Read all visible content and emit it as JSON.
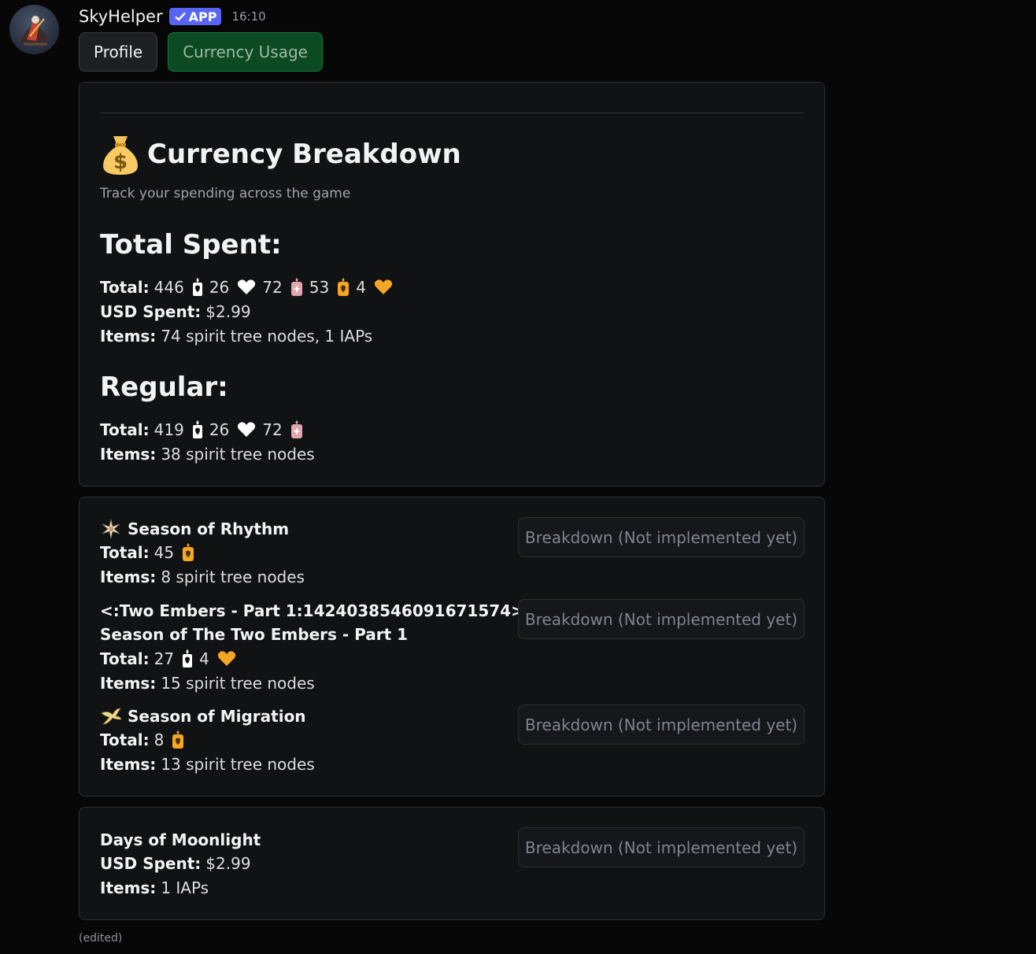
{
  "message": {
    "username": "SkyHelper",
    "badge": "APP",
    "timestamp": "16:10",
    "edited": "(edited)"
  },
  "buttons": {
    "profile": "Profile",
    "currency_usage": "Currency Usage"
  },
  "breakdown_card": {
    "title": "Currency Breakdown",
    "subtitle": "Track your spending across the game",
    "total_spent": {
      "heading": "Total Spent:",
      "total_label": "Total:",
      "values": [
        "446",
        "26",
        "72",
        "53",
        "4"
      ],
      "usd_label": "USD Spent:",
      "usd_value": "$2.99",
      "items_label": "Items:",
      "items_value": "74 spirit tree nodes, 1 IAPs"
    },
    "regular": {
      "heading": "Regular:",
      "total_label": "Total:",
      "values": [
        "419",
        "26",
        "72"
      ],
      "items_label": "Items:",
      "items_value": "38 spirit tree nodes"
    }
  },
  "seasons": [
    {
      "title": "Season of Rhythm",
      "total_label": "Total:",
      "values": [
        "45"
      ],
      "items_label": "Items:",
      "items_value": "8 spirit tree nodes",
      "button": "Breakdown (Not implemented yet)"
    },
    {
      "title_line1": "<:Two Embers - Part 1:1424038546091671574>",
      "title_line2": "Season of The Two Embers - Part 1",
      "total_label": "Total:",
      "values": [
        "27",
        "4"
      ],
      "items_label": "Items:",
      "items_value": "15 spirit tree nodes",
      "button": "Breakdown (Not implemented yet)"
    },
    {
      "title": "Season of Migration",
      "total_label": "Total:",
      "values": [
        "8"
      ],
      "items_label": "Items:",
      "items_value": "13 spirit tree nodes",
      "button": "Breakdown (Not implemented yet)"
    }
  ],
  "event": {
    "title": "Days of Moonlight",
    "usd_label": "USD Spent:",
    "usd_value": "$2.99",
    "items_label": "Items:",
    "items_value": "1 IAPs",
    "button": "Breakdown (Not implemented yet)"
  },
  "colors": {
    "badge": "#5865f2",
    "usage_button_bg": "#0c4a23",
    "season_candle": "#f5a623",
    "gold_heart": "#f5a623",
    "ascended_candle": "#e0a5b0"
  },
  "icons": [
    "candle-icon",
    "heart-icon",
    "ascended-candle-icon",
    "season-candle-icon",
    "season-heart-icon",
    "money-bag-icon"
  ]
}
